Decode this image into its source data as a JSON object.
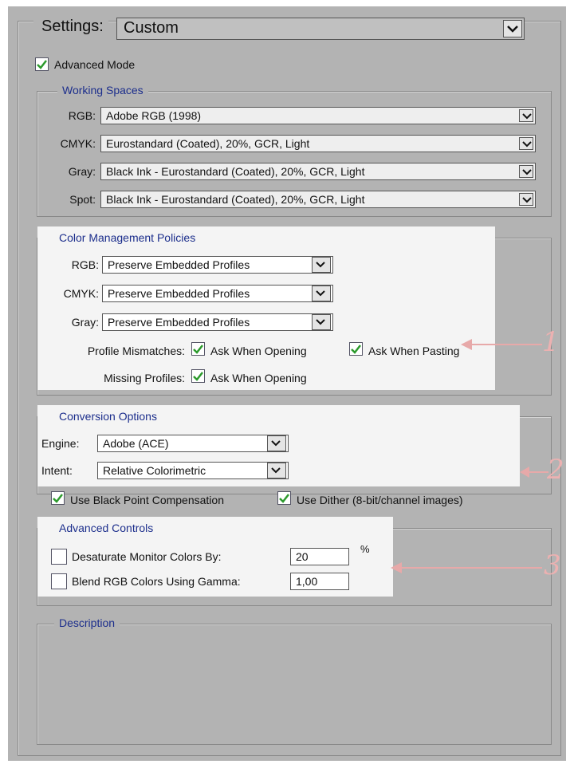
{
  "settings": {
    "label": "Settings:",
    "value": "Custom"
  },
  "advanced_mode": {
    "label": "Advanced Mode",
    "checked": true
  },
  "working_spaces": {
    "title": "Working Spaces",
    "rows": [
      {
        "label": "RGB:",
        "value": "Adobe RGB (1998)"
      },
      {
        "label": "CMYK:",
        "value": "Eurostandard (Coated), 20%, GCR, Light"
      },
      {
        "label": "Gray:",
        "value": "Black Ink - Eurostandard (Coated), 20%, GCR, Light"
      },
      {
        "label": "Spot:",
        "value": "Black Ink - Eurostandard (Coated), 20%, GCR, Light"
      }
    ]
  },
  "policies": {
    "title": "Color Management Policies",
    "rows": [
      {
        "label": "RGB:",
        "value": "Preserve Embedded Profiles"
      },
      {
        "label": "CMYK:",
        "value": "Preserve Embedded Profiles"
      },
      {
        "label": "Gray:",
        "value": "Preserve Embedded Profiles"
      }
    ],
    "profile_mismatches": {
      "label": "Profile Mismatches:",
      "ask_opening": "Ask When Opening",
      "ask_pasting": "Ask When Pasting"
    },
    "missing_profiles": {
      "label": "Missing Profiles:",
      "ask_opening": "Ask When Opening"
    }
  },
  "conversion": {
    "title": "Conversion Options",
    "engine": {
      "label": "Engine:",
      "value": "Adobe (ACE)"
    },
    "intent": {
      "label": "Intent:",
      "value": "Relative Colorimetric"
    },
    "black_point": "Use Black Point Compensation",
    "dither": "Use Dither (8-bit/channel images)"
  },
  "advanced_controls": {
    "title": "Advanced Controls",
    "desaturate": {
      "label": "Desaturate Monitor Colors By:",
      "value": "20",
      "unit": "%",
      "checked": false
    },
    "blend": {
      "label": "Blend RGB Colors Using Gamma:",
      "value": "1,00",
      "checked": false
    }
  },
  "description": {
    "title": "Description"
  },
  "annotations": [
    "1",
    "2",
    "3"
  ],
  "colors": {
    "panel": "#b3b3b3",
    "legend": "#1c2e8c",
    "highlight": "#f4f4f4",
    "annotation": "#e7a9a9",
    "check": "#2c9a2c"
  }
}
